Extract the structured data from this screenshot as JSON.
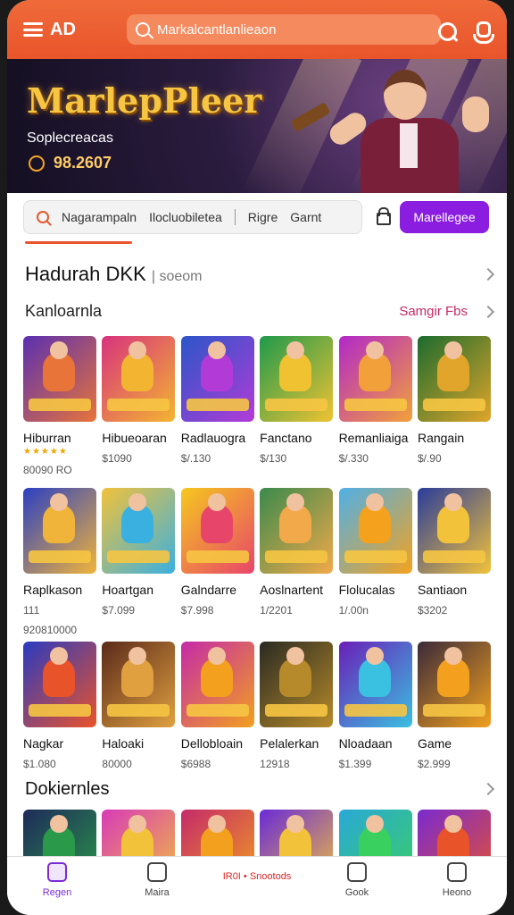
{
  "header": {
    "brand": "AD",
    "search_placeholder": "Markalcantlanlieaon",
    "icons": [
      "menu-icon",
      "search-icon",
      "user-icon"
    ]
  },
  "banner": {
    "title": "MarlepPleer",
    "subtitle": "Soplecreacas",
    "count": "98.2607"
  },
  "filters": {
    "chips": [
      "Nagarampaln",
      "Ilocluobiletea",
      "Rigre",
      "Garnt"
    ],
    "cta_label": "Marellegee"
  },
  "section1": {
    "title": "Hadurah DKK",
    "title_suffix": "| soeom",
    "subtitle": "Kanloarnla",
    "see_all": "Samgir Fbs",
    "row1": [
      {
        "name": "Hiburran",
        "price": "80090 RO",
        "stars": "★★★★★",
        "colors": [
          "#5a2fb0",
          "#e8743a"
        ]
      },
      {
        "name": "Hibueoaran",
        "price": "$1090",
        "colors": [
          "#d8327e",
          "#f3b531"
        ]
      },
      {
        "name": "Radlauogra",
        "price": "$/.130",
        "colors": [
          "#2a56c8",
          "#b23bd8"
        ]
      },
      {
        "name": "Fanctano",
        "price": "$/130",
        "colors": [
          "#1e9a4c",
          "#f0c232"
        ]
      },
      {
        "name": "Remanliaiga",
        "price": "$/.330",
        "colors": [
          "#b227c9",
          "#f2a13a"
        ]
      },
      {
        "name": "Rangain",
        "price": "$/.90",
        "colors": [
          "#1b6b2e",
          "#e0a52a"
        ]
      }
    ],
    "row2": [
      {
        "name": "Raplkason",
        "price": "920810000",
        "extra": "111",
        "colors": [
          "#2b3fc2",
          "#f0b43a"
        ]
      },
      {
        "name": "Hoartgan",
        "price": "$7.099",
        "colors": [
          "#f2c23a",
          "#3ab0e0"
        ]
      },
      {
        "name": "Galndarre",
        "price": "$7.998",
        "colors": [
          "#f5c81e",
          "#e8456a"
        ]
      },
      {
        "name": "Aoslnartent",
        "price": "1/2201",
        "colors": [
          "#3a8a4c",
          "#f2a94a"
        ]
      },
      {
        "name": "Flolucalas",
        "price": "1/.00n",
        "colors": [
          "#4fb0e8",
          "#f4a21e"
        ]
      },
      {
        "name": "Santiaon",
        "price": "$3202",
        "colors": [
          "#2a3c9a",
          "#f2c23a"
        ]
      }
    ],
    "row3": [
      {
        "name": "Nagkar",
        "price": "$1.080",
        "colors": [
          "#2a3ac0",
          "#e9532a"
        ]
      },
      {
        "name": "Haloaki",
        "price": "80000",
        "colors": [
          "#5a2a1a",
          "#e0a040"
        ]
      },
      {
        "name": "Dellobloain",
        "price": "$6988",
        "colors": [
          "#c52aa8",
          "#f2a01e"
        ]
      },
      {
        "name": "Pelalerkan",
        "price": "12918",
        "colors": [
          "#2a2a22",
          "#b68a2a"
        ]
      },
      {
        "name": "Nloadaan",
        "price": "$1.399",
        "colors": [
          "#6a1fb8",
          "#3ac0e0"
        ]
      },
      {
        "name": "Game",
        "price": "$2.999",
        "colors": [
          "#3a2a3a",
          "#f2a01e"
        ]
      }
    ]
  },
  "section2": {
    "title": "Dokiernles",
    "row": [
      {
        "colors": [
          "#1e2a5a",
          "#2a9a4a"
        ]
      },
      {
        "colors": [
          "#d83ab8",
          "#f2c23a"
        ]
      },
      {
        "colors": [
          "#c52a6a",
          "#f2a01e"
        ]
      },
      {
        "colors": [
          "#6a2ad8",
          "#f2c23a"
        ]
      },
      {
        "colors": [
          "#2aa8d8",
          "#3ad060"
        ]
      },
      {
        "colors": [
          "#7a2ad0",
          "#e8532a"
        ]
      }
    ]
  },
  "bottomnav": [
    {
      "label": "Regen",
      "icon": "home-icon",
      "active": true
    },
    {
      "label": "Maira",
      "icon": "camera-icon",
      "active": false
    },
    {
      "label": "IR0I • Snootods",
      "icon": "",
      "active": false
    },
    {
      "label": "Gook",
      "icon": "lock-icon",
      "active": false
    },
    {
      "label": "Heono",
      "icon": "profile-icon",
      "active": false
    }
  ]
}
